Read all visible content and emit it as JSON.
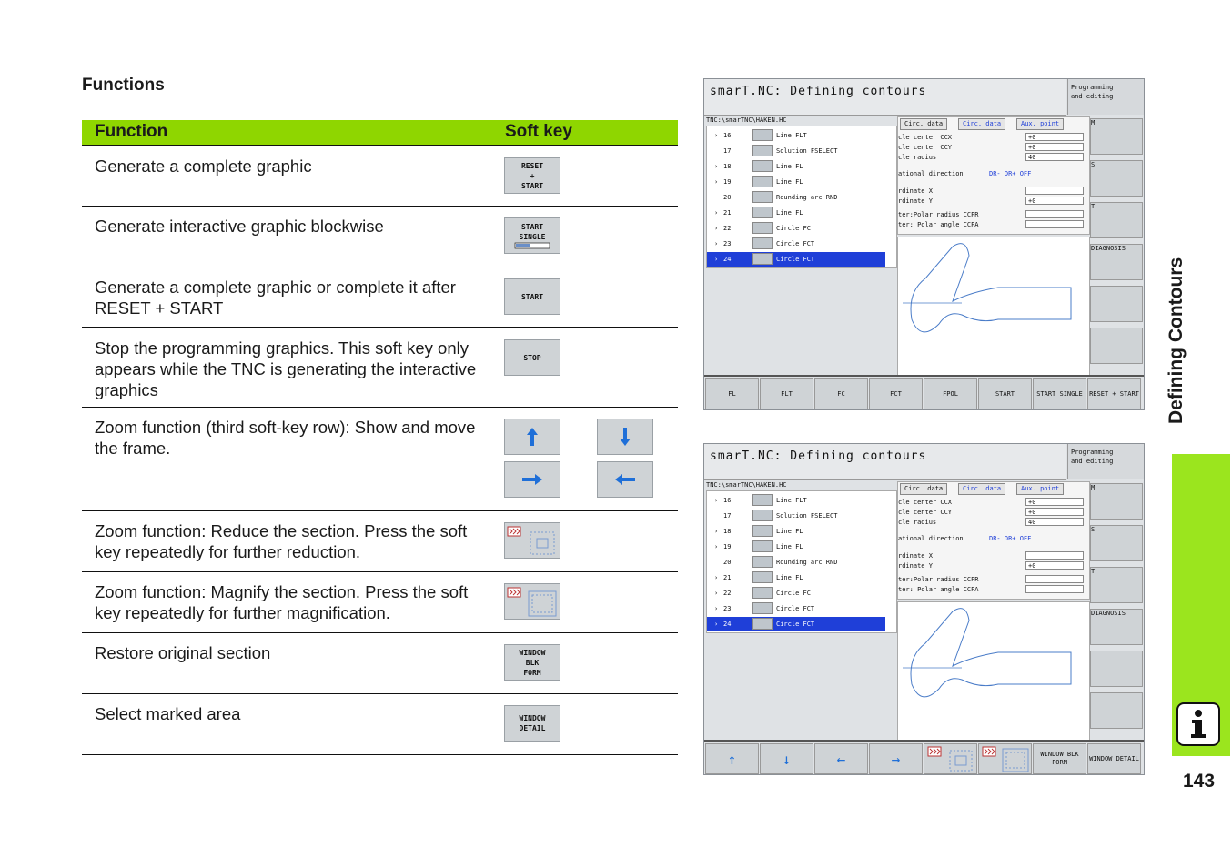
{
  "heading": "Functions",
  "table": {
    "col_function": "Function",
    "col_softkey": "Soft key",
    "rows": [
      {
        "desc": "Generate a complete graphic",
        "keys": [
          [
            "RESET",
            "+",
            "START"
          ]
        ]
      },
      {
        "desc": "Generate interactive graphic blockwise",
        "keys": [
          [
            "START",
            "SINGLE"
          ]
        ]
      },
      {
        "desc": "Generate a complete graphic or complete it after RESET + START",
        "keys": [
          [
            "START"
          ]
        ]
      },
      {
        "desc": "Stop the programming graphics. This soft key only appears while the TNC is generating the interactive graphics",
        "keys": [
          [
            "STOP"
          ]
        ]
      },
      {
        "desc": "Zoom function (third soft-key row): Show and move the frame.",
        "keys": [
          "arrow-up-icon",
          "arrow-down-icon",
          "arrow-right-icon",
          "arrow-left-icon"
        ]
      },
      {
        "desc": "Zoom function: Reduce the section. Press the soft key repeatedly for further reduction.",
        "keys": [
          "zoom-reduce-icon"
        ]
      },
      {
        "desc": "Zoom function: Magnify the section. Press the soft key repeatedly for further magnification.",
        "keys": [
          "zoom-magnify-icon"
        ]
      },
      {
        "desc": "Restore original section",
        "keys": [
          [
            "WINDOW",
            "BLK",
            "FORM"
          ]
        ]
      },
      {
        "desc": "Select marked area",
        "keys": [
          [
            "WINDOW",
            "DETAIL"
          ]
        ]
      }
    ]
  },
  "sidebar": {
    "chapter": "Defining Contours",
    "page": "143",
    "info_icon": "info-icon"
  },
  "screen": {
    "title": "smarT.NC: Defining contours",
    "mode": [
      "Programming",
      "and editing"
    ],
    "path": "TNC:\\smarTNC\\HAKEN.HC",
    "program": [
      {
        "arrow": "›",
        "num": "16",
        "name": "Line FLT"
      },
      {
        "arrow": "",
        "num": "17",
        "name": "Solution FSELECT"
      },
      {
        "arrow": "›",
        "num": "18",
        "name": "Line FL"
      },
      {
        "arrow": "›",
        "num": "19",
        "name": "Line FL"
      },
      {
        "arrow": "",
        "num": "20",
        "name": "Rounding arc RND"
      },
      {
        "arrow": "›",
        "num": "21",
        "name": "Line FL"
      },
      {
        "arrow": "›",
        "num": "22",
        "name": "Circle FC"
      },
      {
        "arrow": "›",
        "num": "23",
        "name": "Circle FCT"
      },
      {
        "arrow": "›",
        "num": "24",
        "name": "Circle FCT"
      }
    ],
    "tabs": [
      "Circ. data",
      "Circ. data",
      "Aux. point"
    ],
    "fields": [
      {
        "label": "cle center CCX",
        "value": "+0"
      },
      {
        "label": "cle center CCY",
        "value": "+0"
      },
      {
        "label": "cle radius",
        "value": "40"
      },
      {
        "label": "ational direction",
        "value": "DR-  DR+  OFF"
      },
      {
        "label": "rdinate X",
        "value": ""
      },
      {
        "label": "rdinate Y",
        "value": "+0"
      },
      {
        "label": "ter:Polar radius CCPR",
        "value": ""
      },
      {
        "label": "ter: Polar angle CCPA",
        "value": ""
      }
    ],
    "vkeys": [
      "M",
      "S",
      "T",
      "DIAGNOSIS",
      "",
      ""
    ],
    "hkeys_1": [
      "FL",
      "FLT",
      "FC",
      "FCT",
      "FPOL",
      "START",
      "START SINGLE",
      "RESET + START"
    ],
    "hkeys_2": [
      "↑",
      "↓",
      "←",
      "→",
      "",
      "",
      "WINDOW BLK FORM",
      "WINDOW DETAIL"
    ]
  }
}
